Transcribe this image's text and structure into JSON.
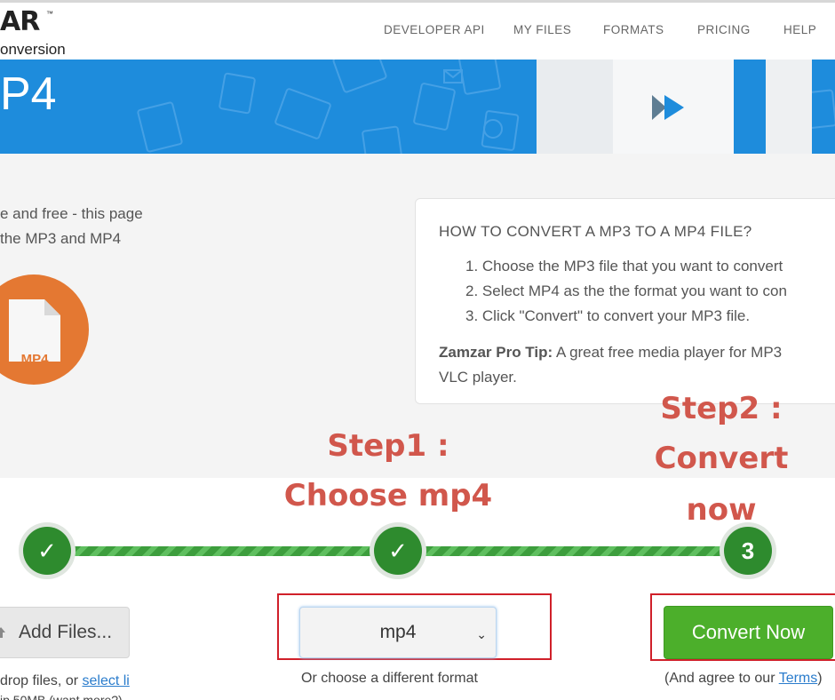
{
  "header": {
    "logo_text": "AR",
    "logo_tm": "™",
    "logo_sub": "onversion",
    "nav": [
      "DEVELOPER API",
      "MY FILES",
      "FORMATS",
      "PRICING",
      "HELP"
    ]
  },
  "banner": {
    "title": "P4"
  },
  "intro": {
    "line1": "e and free - this page",
    "line2": "the MP3 and MP4"
  },
  "file_icon": {
    "label": "MP4",
    "circle_color": "#e47832",
    "label_color": "#e47832"
  },
  "howto": {
    "title": "HOW TO CONVERT A MP3 TO A MP4 FILE?",
    "steps": [
      "1. Choose the MP3 file that you want to convert",
      "2. Select MP4 as the the format you want to con",
      "3. Click \"Convert\" to convert your MP3 file."
    ],
    "tip_label": "Zamzar Pro Tip:",
    "tip_text": " A great free media player for MP3",
    "tip_text2": "VLC player."
  },
  "annotations": {
    "step1_line1": "Step1 :",
    "step1_line2": "Choose mp4",
    "step2_line1": "Step2 :",
    "step2_line2": "Convert",
    "step2_line3": "now"
  },
  "steps": {
    "step1_mark": "✓",
    "step2_mark": "✓",
    "step3_mark": "3"
  },
  "add_files": {
    "label": "Add Files...",
    "drop_hint_prefix": "drop files, or ",
    "drop_hint_link": "select li",
    "size_hint": "ip 50MB (want more?)"
  },
  "format": {
    "selected": "mp4",
    "hint": "Or choose a different format"
  },
  "convert": {
    "label": "Convert Now",
    "terms_prefix": "(And agree to our ",
    "terms_link": "Terms",
    "terms_suffix": ")"
  },
  "colors": {
    "banner": "#1e8cdc",
    "step_green": "#2e8b2e",
    "convert_green": "#4caf2b",
    "annotation_red": "#d1574c",
    "highlight_box": "#d0202a"
  }
}
